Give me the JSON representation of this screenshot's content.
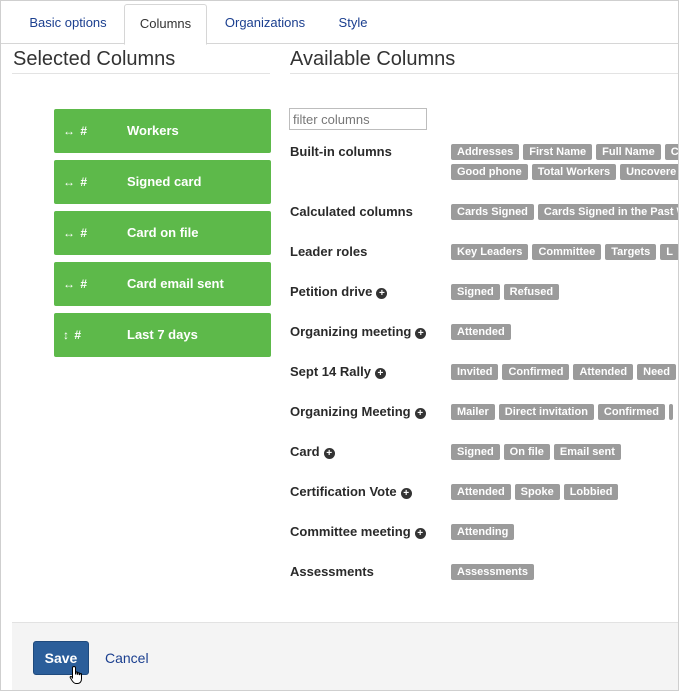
{
  "tabs": [
    {
      "label": "Basic options",
      "active": false
    },
    {
      "label": "Columns",
      "active": true
    },
    {
      "label": "Organizations",
      "active": false
    },
    {
      "label": "Style",
      "active": false
    }
  ],
  "selected": {
    "heading": "Selected Columns",
    "items": [
      {
        "icon": "↔ #",
        "label": "Workers"
      },
      {
        "icon": "↔ #",
        "label": "Signed card"
      },
      {
        "icon": "↔ #",
        "label": "Card on file"
      },
      {
        "icon": "↔ #",
        "label": "Card email sent"
      },
      {
        "icon": "↕ #",
        "label": "Last 7 days"
      }
    ]
  },
  "available": {
    "heading": "Available Columns",
    "filter_placeholder": "filter columns",
    "groups": [
      {
        "name": "Built-in columns",
        "has_add": false,
        "tags": [
          "Addresses",
          "First Name",
          "Full Name",
          "C"
        ],
        "tags2": [
          "Good phone",
          "Total Workers",
          "Uncovere"
        ]
      },
      {
        "name": "Calculated columns",
        "has_add": false,
        "tags": [
          "Cards Signed",
          "Cards Signed in the Past W"
        ]
      },
      {
        "name": "Leader roles",
        "has_add": false,
        "tags": [
          "Key Leaders",
          "Committee",
          "Targets",
          "L"
        ]
      },
      {
        "name": "Petition drive",
        "has_add": true,
        "tags": [
          "Signed",
          "Refused"
        ]
      },
      {
        "name": "Organizing meeting",
        "has_add": true,
        "tags": [
          "Attended"
        ]
      },
      {
        "name": "Sept 14 Rally",
        "has_add": true,
        "tags": [
          "Invited",
          "Confirmed",
          "Attended",
          "Need"
        ]
      },
      {
        "name": "Organizing Meeting",
        "has_add": true,
        "tags": [
          "Mailer",
          "Direct invitation",
          "Confirmed",
          ""
        ]
      },
      {
        "name": "Card",
        "has_add": true,
        "tags": [
          "Signed",
          "On file",
          "Email sent"
        ]
      },
      {
        "name": "Certification Vote",
        "has_add": true,
        "tags": [
          "Attended",
          "Spoke",
          "Lobbied"
        ]
      },
      {
        "name": "Committee meeting",
        "has_add": true,
        "tags": [
          "Attending"
        ]
      },
      {
        "name": "Assessments",
        "has_add": false,
        "tags": [
          "Assessments"
        ]
      }
    ]
  },
  "footer": {
    "save_label": "Save",
    "cancel_label": "Cancel"
  },
  "colors": {
    "accent_green": "#5db94a",
    "tag_gray": "#9b9b9b",
    "save_blue": "#2b5e9a",
    "link_blue": "#1b3f8f"
  }
}
